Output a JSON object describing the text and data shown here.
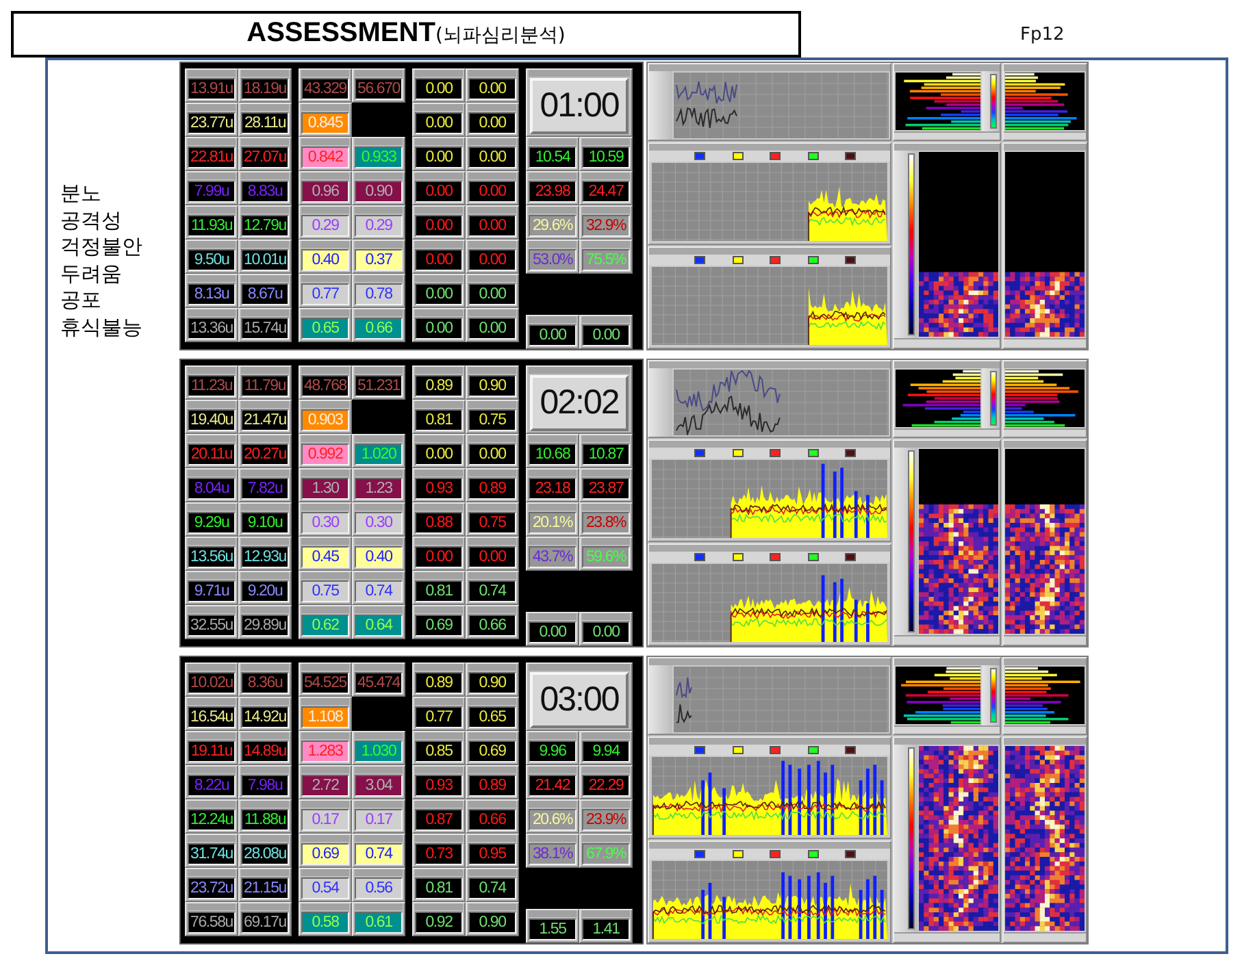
{
  "title": "**ASSESSMENT**(뇌파심리분석)",
  "channel": "Fp12",
  "emotions": [
    "분노",
    "공격성",
    "걱정불안",
    "두려움",
    "공포",
    "휴식불능"
  ],
  "panels": [
    {
      "timer": "01:00",
      "block_1": [
        [
          "13.91u",
          "18.19u"
        ],
        [
          "23.77u",
          "28.11u"
        ],
        [
          "22.81u",
          "27.07u"
        ],
        [
          "7.99u",
          "8.83u"
        ],
        [
          "11.93u",
          "12.79u"
        ],
        [
          "9.50u",
          "10.01u"
        ],
        [
          "8.13u",
          "8.67u"
        ],
        [
          "13.36u",
          "15.74u"
        ]
      ],
      "block_2": [
        [
          "43.329",
          "56.670"
        ],
        [
          "0.845"
        ],
        [
          "0.842",
          "0.933"
        ],
        [
          "0.96",
          "0.90"
        ],
        [
          "0.29",
          "0.29"
        ],
        [
          "0.40",
          "0.37"
        ],
        [
          "0.77",
          "0.78"
        ],
        [
          "0.65",
          "0.66"
        ]
      ],
      "block_3": [
        [
          "0.00",
          "0.00"
        ],
        [
          "0.00",
          "0.00"
        ],
        [
          "0.00",
          "0.00"
        ],
        [
          "0.00",
          "0.00"
        ],
        [
          "0.00",
          "0.00"
        ],
        [
          "0.00",
          "0.00"
        ],
        [
          "0.00",
          "0.00"
        ],
        [
          "0.00",
          "0.00"
        ]
      ],
      "block_4": [
        [
          "10.54",
          "10.59"
        ],
        [
          "23.98",
          "24.47"
        ],
        [
          "29.6%",
          "32.9%"
        ],
        [
          "53.0%",
          "75.5%"
        ]
      ],
      "block_4_footer": [
        "0.00",
        "0.00"
      ]
    },
    {
      "timer": "02:02",
      "block_1": [
        [
          "11.23u",
          "11.79u"
        ],
        [
          "19.40u",
          "21.47u"
        ],
        [
          "20.11u",
          "20.27u"
        ],
        [
          "8.04u",
          "7.82u"
        ],
        [
          "9.29u",
          "9.10u"
        ],
        [
          "13.56u",
          "12.93u"
        ],
        [
          "9.71u",
          "9.20u"
        ],
        [
          "32.55u",
          "29.89u"
        ]
      ],
      "block_2": [
        [
          "48.768",
          "51.231"
        ],
        [
          "0.903"
        ],
        [
          "0.992",
          "1.020"
        ],
        [
          "1.30",
          "1.23"
        ],
        [
          "0.30",
          "0.30"
        ],
        [
          "0.45",
          "0.40"
        ],
        [
          "0.75",
          "0.74"
        ],
        [
          "0.62",
          "0.64"
        ]
      ],
      "block_3": [
        [
          "0.89",
          "0.90"
        ],
        [
          "0.81",
          "0.75"
        ],
        [
          "0.00",
          "0.00"
        ],
        [
          "0.93",
          "0.89"
        ],
        [
          "0.88",
          "0.75"
        ],
        [
          "0.00",
          "0.00"
        ],
        [
          "0.81",
          "0.74"
        ],
        [
          "0.69",
          "0.66"
        ]
      ],
      "block_4": [
        [
          "10.68",
          "10.87"
        ],
        [
          "23.18",
          "23.87"
        ],
        [
          "20.1%",
          "23.8%"
        ],
        [
          "43.7%",
          "59.6%"
        ]
      ],
      "block_4_footer": [
        "0.00",
        "0.00"
      ]
    },
    {
      "timer": "03:00",
      "block_1": [
        [
          "10.02u",
          "8.36u"
        ],
        [
          "16.54u",
          "14.92u"
        ],
        [
          "19.11u",
          "14.89u"
        ],
        [
          "8.22u",
          "7.98u"
        ],
        [
          "12.24u",
          "11.88u"
        ],
        [
          "31.74u",
          "28.08u"
        ],
        [
          "23.72u",
          "21.15u"
        ],
        [
          "76.58u",
          "69.17u"
        ]
      ],
      "block_2": [
        [
          "54.525",
          "45.474"
        ],
        [
          "1.108"
        ],
        [
          "1.283",
          "1.030"
        ],
        [
          "2.72",
          "3.04"
        ],
        [
          "0.17",
          "0.17"
        ],
        [
          "0.69",
          "0.74"
        ],
        [
          "0.54",
          "0.56"
        ],
        [
          "0.58",
          "0.61"
        ]
      ],
      "block_3": [
        [
          "0.89",
          "0.90"
        ],
        [
          "0.77",
          "0.65"
        ],
        [
          "0.85",
          "0.69"
        ],
        [
          "0.93",
          "0.89"
        ],
        [
          "0.87",
          "0.66"
        ],
        [
          "0.73",
          "0.95"
        ],
        [
          "0.81",
          "0.74"
        ],
        [
          "0.92",
          "0.90"
        ]
      ],
      "block_4": [
        [
          "9.96",
          "9.94"
        ],
        [
          "21.42",
          "22.29"
        ],
        [
          "20.6%",
          "23.9%"
        ],
        [
          "38.1%",
          "67.9%"
        ]
      ],
      "block_4_footer": [
        "1.55",
        "1.41"
      ]
    }
  ]
}
